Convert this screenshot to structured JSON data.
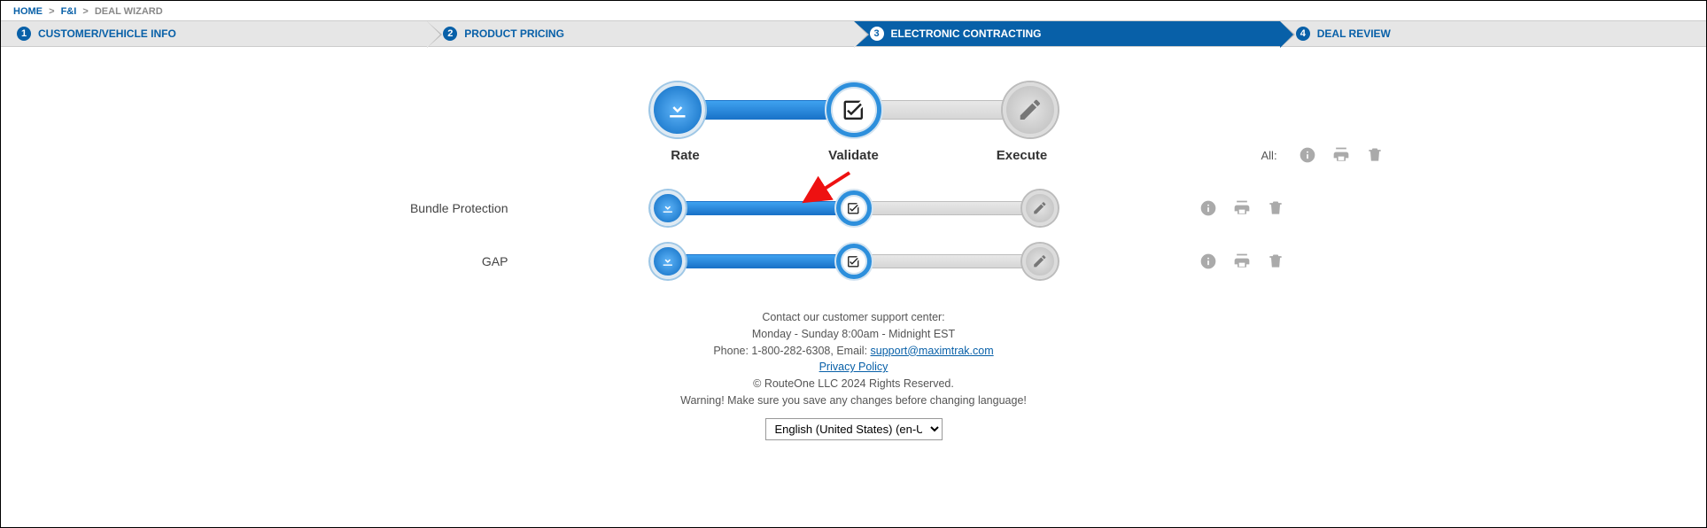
{
  "breadcrumb": {
    "home": "HOME",
    "fni": "F&I",
    "current": "DEAL WIZARD"
  },
  "steps": [
    {
      "num": "1",
      "label": "CUSTOMER/VEHICLE INFO"
    },
    {
      "num": "2",
      "label": "PRODUCT PRICING"
    },
    {
      "num": "3",
      "label": "ELECTRONIC CONTRACTING"
    },
    {
      "num": "4",
      "label": "DEAL REVIEW"
    }
  ],
  "process": {
    "labels": {
      "rate": "Rate",
      "validate": "Validate",
      "execute": "Execute"
    },
    "all": "All:"
  },
  "rows": [
    {
      "name": "Bundle Protection"
    },
    {
      "name": "GAP"
    }
  ],
  "footer": {
    "contact": "Contact our customer support center:",
    "hours": "Monday - Sunday 8:00am - Midnight EST",
    "phone_prefix": "Phone: 1-800-282-6308, Email: ",
    "email": "support@maximtrak.com",
    "privacy": "Privacy Policy",
    "copyright": "© RouteOne LLC 2024 Rights Reserved.",
    "warning": "Warning! Make sure you save any changes before changing language!",
    "language": "English (United States) (en-US)"
  }
}
